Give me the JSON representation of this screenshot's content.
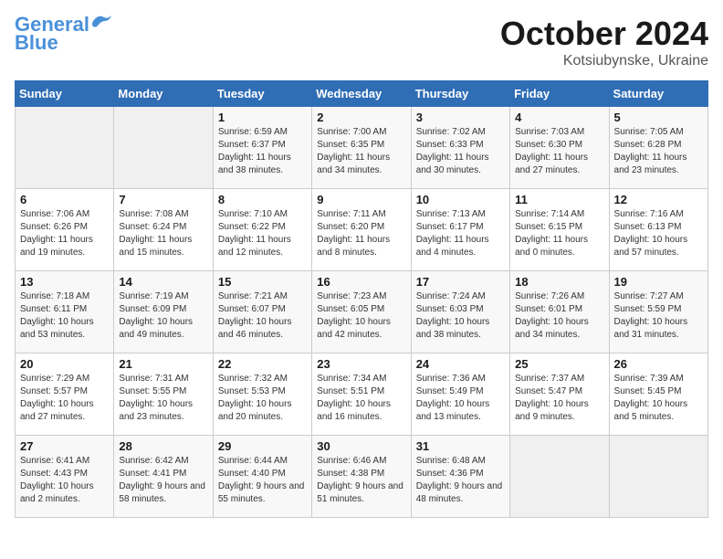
{
  "header": {
    "logo_line1": "General",
    "logo_line2": "Blue",
    "month": "October 2024",
    "location": "Kotsiubynske, Ukraine"
  },
  "weekdays": [
    "Sunday",
    "Monday",
    "Tuesday",
    "Wednesday",
    "Thursday",
    "Friday",
    "Saturday"
  ],
  "weeks": [
    [
      {
        "day": "",
        "info": ""
      },
      {
        "day": "",
        "info": ""
      },
      {
        "day": "1",
        "info": "Sunrise: 6:59 AM\nSunset: 6:37 PM\nDaylight: 11 hours and 38 minutes."
      },
      {
        "day": "2",
        "info": "Sunrise: 7:00 AM\nSunset: 6:35 PM\nDaylight: 11 hours and 34 minutes."
      },
      {
        "day": "3",
        "info": "Sunrise: 7:02 AM\nSunset: 6:33 PM\nDaylight: 11 hours and 30 minutes."
      },
      {
        "day": "4",
        "info": "Sunrise: 7:03 AM\nSunset: 6:30 PM\nDaylight: 11 hours and 27 minutes."
      },
      {
        "day": "5",
        "info": "Sunrise: 7:05 AM\nSunset: 6:28 PM\nDaylight: 11 hours and 23 minutes."
      }
    ],
    [
      {
        "day": "6",
        "info": "Sunrise: 7:06 AM\nSunset: 6:26 PM\nDaylight: 11 hours and 19 minutes."
      },
      {
        "day": "7",
        "info": "Sunrise: 7:08 AM\nSunset: 6:24 PM\nDaylight: 11 hours and 15 minutes."
      },
      {
        "day": "8",
        "info": "Sunrise: 7:10 AM\nSunset: 6:22 PM\nDaylight: 11 hours and 12 minutes."
      },
      {
        "day": "9",
        "info": "Sunrise: 7:11 AM\nSunset: 6:20 PM\nDaylight: 11 hours and 8 minutes."
      },
      {
        "day": "10",
        "info": "Sunrise: 7:13 AM\nSunset: 6:17 PM\nDaylight: 11 hours and 4 minutes."
      },
      {
        "day": "11",
        "info": "Sunrise: 7:14 AM\nSunset: 6:15 PM\nDaylight: 11 hours and 0 minutes."
      },
      {
        "day": "12",
        "info": "Sunrise: 7:16 AM\nSunset: 6:13 PM\nDaylight: 10 hours and 57 minutes."
      }
    ],
    [
      {
        "day": "13",
        "info": "Sunrise: 7:18 AM\nSunset: 6:11 PM\nDaylight: 10 hours and 53 minutes."
      },
      {
        "day": "14",
        "info": "Sunrise: 7:19 AM\nSunset: 6:09 PM\nDaylight: 10 hours and 49 minutes."
      },
      {
        "day": "15",
        "info": "Sunrise: 7:21 AM\nSunset: 6:07 PM\nDaylight: 10 hours and 46 minutes."
      },
      {
        "day": "16",
        "info": "Sunrise: 7:23 AM\nSunset: 6:05 PM\nDaylight: 10 hours and 42 minutes."
      },
      {
        "day": "17",
        "info": "Sunrise: 7:24 AM\nSunset: 6:03 PM\nDaylight: 10 hours and 38 minutes."
      },
      {
        "day": "18",
        "info": "Sunrise: 7:26 AM\nSunset: 6:01 PM\nDaylight: 10 hours and 34 minutes."
      },
      {
        "day": "19",
        "info": "Sunrise: 7:27 AM\nSunset: 5:59 PM\nDaylight: 10 hours and 31 minutes."
      }
    ],
    [
      {
        "day": "20",
        "info": "Sunrise: 7:29 AM\nSunset: 5:57 PM\nDaylight: 10 hours and 27 minutes."
      },
      {
        "day": "21",
        "info": "Sunrise: 7:31 AM\nSunset: 5:55 PM\nDaylight: 10 hours and 23 minutes."
      },
      {
        "day": "22",
        "info": "Sunrise: 7:32 AM\nSunset: 5:53 PM\nDaylight: 10 hours and 20 minutes."
      },
      {
        "day": "23",
        "info": "Sunrise: 7:34 AM\nSunset: 5:51 PM\nDaylight: 10 hours and 16 minutes."
      },
      {
        "day": "24",
        "info": "Sunrise: 7:36 AM\nSunset: 5:49 PM\nDaylight: 10 hours and 13 minutes."
      },
      {
        "day": "25",
        "info": "Sunrise: 7:37 AM\nSunset: 5:47 PM\nDaylight: 10 hours and 9 minutes."
      },
      {
        "day": "26",
        "info": "Sunrise: 7:39 AM\nSunset: 5:45 PM\nDaylight: 10 hours and 5 minutes."
      }
    ],
    [
      {
        "day": "27",
        "info": "Sunrise: 6:41 AM\nSunset: 4:43 PM\nDaylight: 10 hours and 2 minutes."
      },
      {
        "day": "28",
        "info": "Sunrise: 6:42 AM\nSunset: 4:41 PM\nDaylight: 9 hours and 58 minutes."
      },
      {
        "day": "29",
        "info": "Sunrise: 6:44 AM\nSunset: 4:40 PM\nDaylight: 9 hours and 55 minutes."
      },
      {
        "day": "30",
        "info": "Sunrise: 6:46 AM\nSunset: 4:38 PM\nDaylight: 9 hours and 51 minutes."
      },
      {
        "day": "31",
        "info": "Sunrise: 6:48 AM\nSunset: 4:36 PM\nDaylight: 9 hours and 48 minutes."
      },
      {
        "day": "",
        "info": ""
      },
      {
        "day": "",
        "info": ""
      }
    ]
  ]
}
